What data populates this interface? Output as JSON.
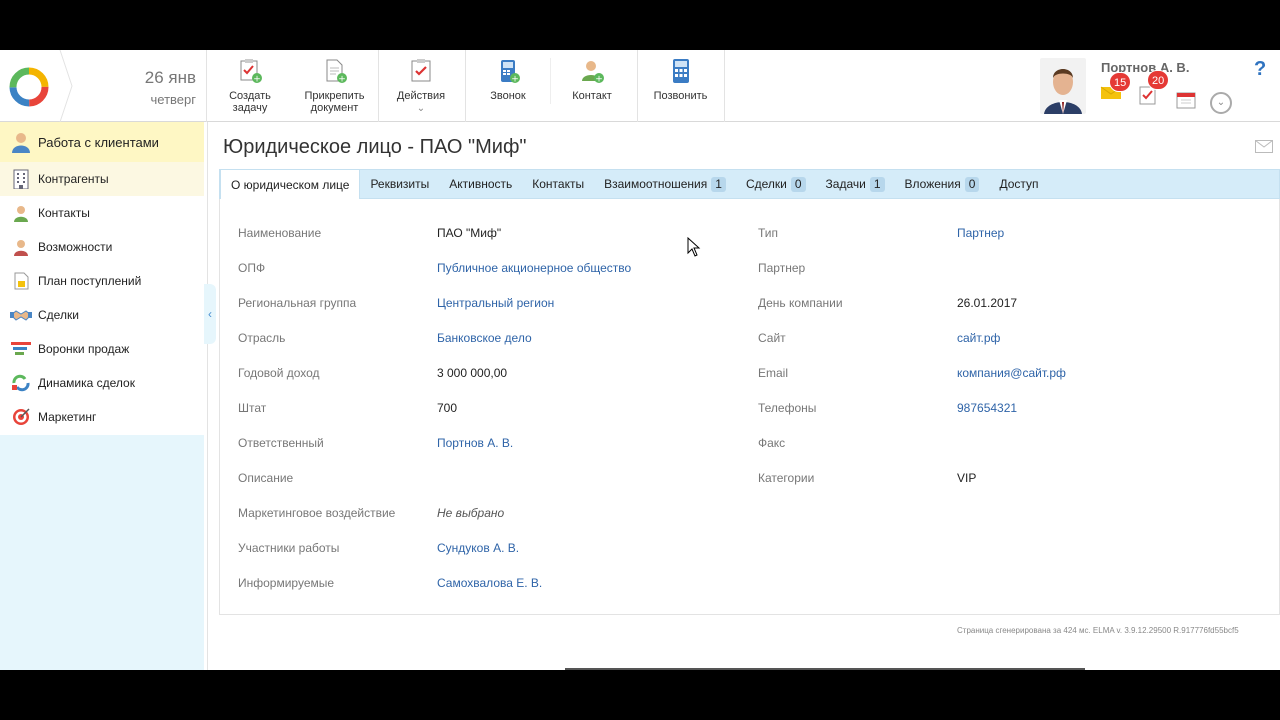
{
  "header": {
    "date_day": "26 янв",
    "date_weekday": "четверг",
    "toolbar": [
      {
        "id": "create-task",
        "label1": "Создать",
        "label2": "задачу"
      },
      {
        "id": "attach-doc",
        "label1": "Прикрепить",
        "label2": "документ"
      },
      {
        "id": "actions",
        "label1": "Действия"
      },
      {
        "id": "call-log",
        "label1": "Звонок"
      },
      {
        "id": "contact",
        "label1": "Контакт"
      },
      {
        "id": "call",
        "label1": "Позвонить"
      }
    ],
    "user_name": "Портнов А. В.",
    "messages_count": "15",
    "tasks_count": "20",
    "help": "?"
  },
  "sidebar": {
    "items": [
      {
        "label": "Работа с клиентами",
        "icon": "person-icon"
      },
      {
        "label": "Контрагенты",
        "icon": "building-icon"
      },
      {
        "label": "Контакты",
        "icon": "contact-icon"
      },
      {
        "label": "Возможности",
        "icon": "opportunity-icon"
      },
      {
        "label": "План поступлений",
        "icon": "plan-icon"
      },
      {
        "label": "Сделки",
        "icon": "handshake-icon"
      },
      {
        "label": "Воронки продаж",
        "icon": "funnel-icon"
      },
      {
        "label": "Динамика сделок",
        "icon": "dynamics-icon"
      },
      {
        "label": "Маркетинг",
        "icon": "target-icon"
      }
    ]
  },
  "main": {
    "title": "Юридическое лицо - ПАО \"Миф\"",
    "tabs": [
      {
        "label": "О юридическом лице",
        "count": null
      },
      {
        "label": "Реквизиты",
        "count": null
      },
      {
        "label": "Активность",
        "count": null
      },
      {
        "label": "Контакты",
        "count": null
      },
      {
        "label": "Взаимоотношения",
        "count": "1"
      },
      {
        "label": "Сделки",
        "count": "0"
      },
      {
        "label": "Задачи",
        "count": "1"
      },
      {
        "label": "Вложения",
        "count": "0"
      },
      {
        "label": "Доступ",
        "count": null
      }
    ],
    "left_fields": [
      {
        "label": "Наименование",
        "value": "ПАО \"Миф\"",
        "kind": "text"
      },
      {
        "label": "ОПФ",
        "value": "Публичное акционерное общество",
        "kind": "link"
      },
      {
        "label": "Региональная группа",
        "value": "Центральный регион",
        "kind": "link"
      },
      {
        "label": "Отрасль",
        "value": "Банковское дело",
        "kind": "link"
      },
      {
        "label": "Годовой доход",
        "value": "3 000 000,00",
        "kind": "text"
      },
      {
        "label": "Штат",
        "value": "700",
        "kind": "text"
      },
      {
        "label": "Ответственный",
        "value": "Портнов А. В.",
        "kind": "link"
      },
      {
        "label": "Описание",
        "value": "",
        "kind": "text"
      },
      {
        "label": "Маркетинговое воздействие",
        "value": "Не выбрано",
        "kind": "italic"
      },
      {
        "label": "Участники работы",
        "value": "Сундуков А. В.",
        "kind": "link"
      },
      {
        "label": "Информируемые",
        "value": "Самохвалова Е. В.",
        "kind": "link"
      }
    ],
    "right_fields": [
      {
        "label": "Тип",
        "value": "Партнер",
        "kind": "link"
      },
      {
        "label": "Партнер",
        "value": "",
        "kind": "text"
      },
      {
        "label": "День компании",
        "value": "26.01.2017",
        "kind": "text"
      },
      {
        "label": "Сайт",
        "value": "сайт.рф",
        "kind": "link"
      },
      {
        "label": "Email",
        "value": "компания@сайт.рф",
        "kind": "link"
      },
      {
        "label": "Телефоны",
        "value": "987654321",
        "kind": "link"
      },
      {
        "label": "Факс",
        "value": "",
        "kind": "text"
      },
      {
        "label": "Категории",
        "value": "VIP",
        "kind": "text"
      }
    ],
    "footer": "Страница сгенерирована за 424 мс. ELMA v. 3.9.12.29500 R.917776fd55bcf5"
  }
}
